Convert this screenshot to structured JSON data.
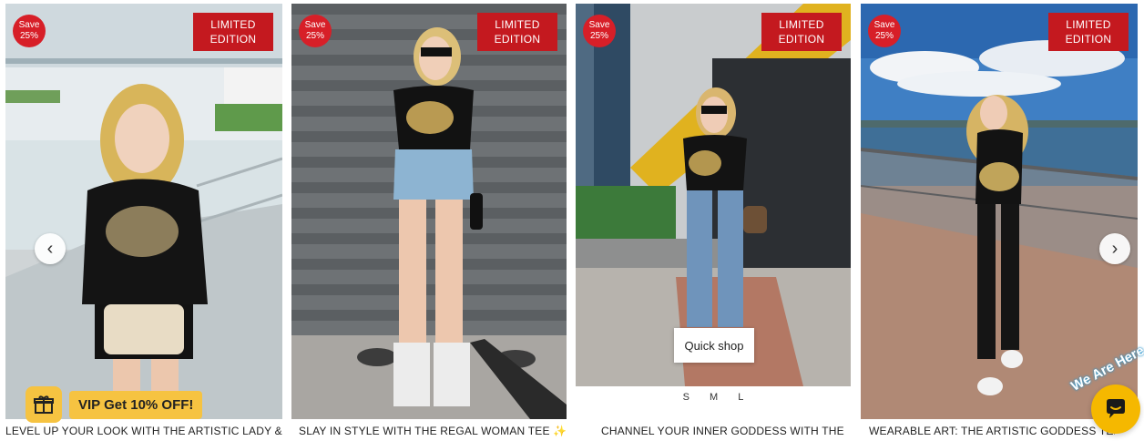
{
  "products": [
    {
      "save_badge": "Save 25%",
      "save_word": "Save",
      "save_pct": "25%",
      "limited_line1": "LIMITED",
      "limited_line2": "EDITION",
      "caption": "LEVEL UP YOUR LOOK WITH THE ARTISTIC LADY &"
    },
    {
      "save_badge": "Save 25%",
      "save_word": "Save",
      "save_pct": "25%",
      "limited_line1": "LIMITED",
      "limited_line2": "EDITION",
      "caption": "SLAY IN STYLE WITH THE REGAL WOMAN TEE ✨"
    },
    {
      "save_badge": "Save 25%",
      "save_word": "Save",
      "save_pct": "25%",
      "limited_line1": "LIMITED",
      "limited_line2": "EDITION",
      "caption": "CHANNEL YOUR INNER GODDESS WITH THE"
    },
    {
      "save_badge": "Save 25%",
      "save_word": "Save",
      "save_pct": "25%",
      "limited_line1": "LIMITED",
      "limited_line2": "EDITION",
      "caption": "WEARABLE ART: THE ARTISTIC GODDESS TEE ✨"
    }
  ],
  "quick_shop_label": "Quick shop",
  "sizes": [
    "S",
    "M",
    "L"
  ],
  "carousel": {
    "prev_icon": "chevron-left-icon",
    "next_icon": "chevron-right-icon"
  },
  "vip": {
    "label": "VIP Get 10% OFF!",
    "icon": "gift-icon"
  },
  "chat": {
    "tagline": "We Are Here",
    "icon": "chat-bubble-icon"
  },
  "colors": {
    "sale_red": "#d71f28",
    "limited_red": "#c4191f",
    "vip_yellow": "#f6c341",
    "chat_yellow": "#f5b800"
  }
}
